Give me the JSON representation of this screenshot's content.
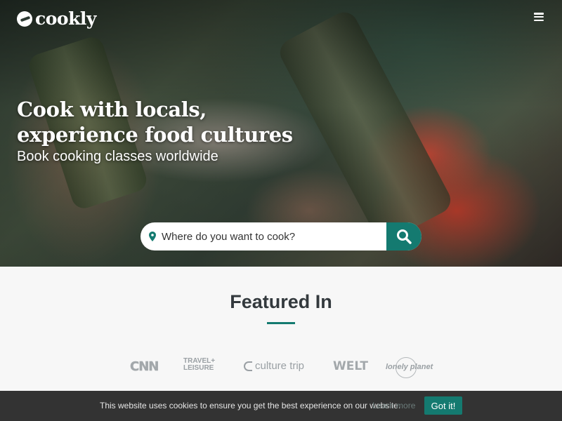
{
  "header": {
    "logo_text": "cookly",
    "logo_icon": "cookly-logo-icon",
    "menu_icon": "hamburger-menu-icon"
  },
  "hero": {
    "headline_line1": "Cook with locals,",
    "headline_line2": "experience food cultures",
    "subheadline": "Book cooking classes worldwide",
    "search": {
      "placeholder": "Where do you want to cook?",
      "value": "",
      "location_icon": "map-pin-icon",
      "button_icon": "search-icon"
    }
  },
  "featured": {
    "title": "Featured In",
    "press": {
      "cnn": "CNN",
      "travel_leisure_line1": "TRAVEL+",
      "travel_leisure_line2": "LEISURE",
      "culture_trip": "culture trip",
      "welt": "WELT",
      "lonely_planet": "lonely planet"
    }
  },
  "cookie_bar": {
    "message": "This website uses cookies to ensure you get the best experience on our website.",
    "learn_more": "Learn more",
    "accept": "Got it!"
  },
  "colors": {
    "accent": "#147a70",
    "heading": "#33393d",
    "cookie_bg": "#333333",
    "page_bg": "#f7f7f7"
  }
}
